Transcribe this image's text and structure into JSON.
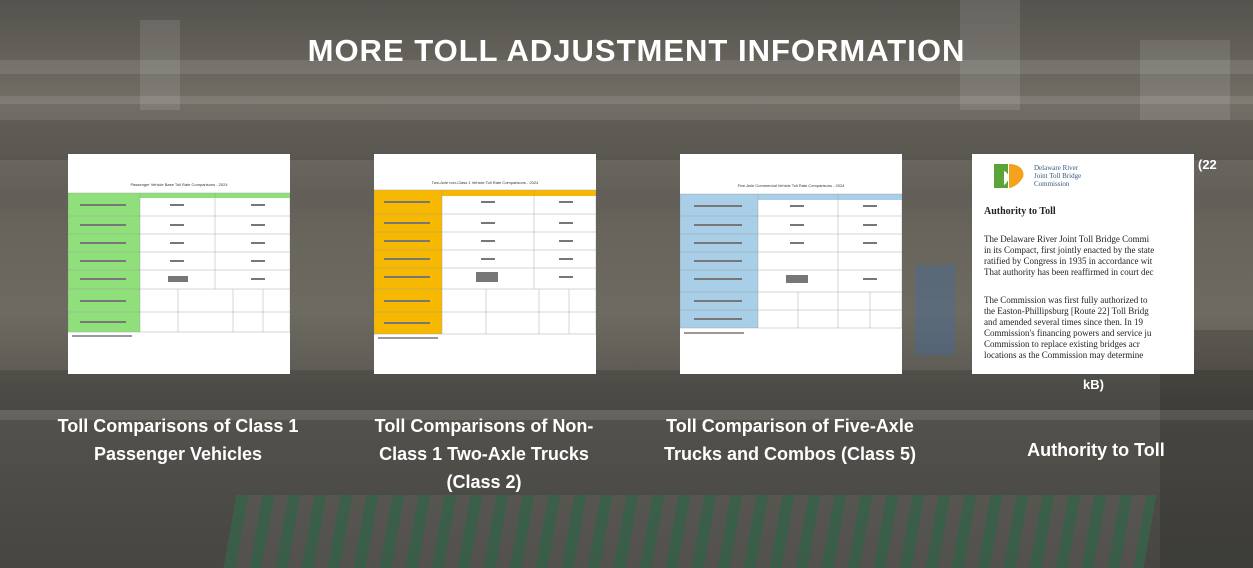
{
  "section": {
    "title": "MORE TOLL ADJUSTMENT INFORMATION"
  },
  "cards": [
    {
      "caption_line1": "Toll Comparisons of Class 1",
      "caption_line2": "Passenger Vehicles",
      "accent": "#8fe07a",
      "doc_title": "Passenger Vehicle Base Toll Rate Comparisons - 2024"
    },
    {
      "caption_line1": "Toll Comparisons of Non-",
      "caption_line2": "Class 1 Two-Axle Trucks",
      "caption_line3": "(Class 2)",
      "accent": "#f6b800",
      "doc_title": "Two-Axle non-Class 1 Vehicle Toll Rate Comparisons - 2024"
    },
    {
      "caption_line1": "Toll Comparison of Five-Axle",
      "caption_line2": "Trucks and Combos (Class 5)",
      "accent": "#a9cfe8",
      "doc_title": "Five-Axle Commercial Vehicle Toll Rate Comparisons - 2024"
    },
    {
      "caption": "Authority to Toll",
      "size_prefix": "(22",
      "size_suffix": "kB)",
      "doc": {
        "org_line1": "Delaware River",
        "org_line2": "Joint Toll Bridge",
        "org_line3": "Commission",
        "heading": "Authority to Toll",
        "lines": [
          "The Delaware River Joint Toll Bridge Commi",
          "in its Compact, first jointly enacted by the state",
          "ratified by Congress in 1935 in accordance wit",
          "That authority has been reaffirmed in court dec",
          "",
          "The Commission was first fully authorized to",
          "the Easton-Phillipsburg [Route 22] Toll Bridg",
          "and amended several times since then.  In 19",
          "Commission's financing powers and service ju",
          "Commission to replace existing bridges acr",
          "locations as the Commission may determine"
        ]
      }
    }
  ]
}
